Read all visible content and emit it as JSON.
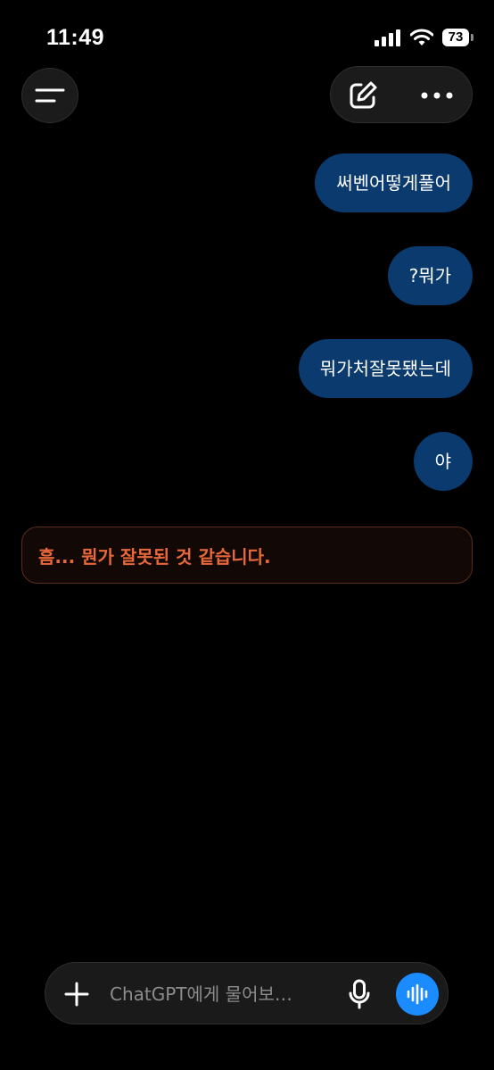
{
  "status_bar": {
    "time": "11:49",
    "battery_level": "73",
    "icons": [
      "signal-icon",
      "wifi-icon",
      "battery-icon"
    ]
  },
  "header": {
    "left_icon": "menu-icon",
    "right_icons": [
      "compose-icon",
      "more-icon"
    ]
  },
  "messages": [
    {
      "role": "user",
      "text": "써벤어떻게풀어"
    },
    {
      "role": "user",
      "text": "?뭐가"
    },
    {
      "role": "user",
      "text": "뭐가처잘못됐는데"
    },
    {
      "role": "user",
      "text": "야"
    }
  ],
  "error": {
    "text": "흠... 뭔가 잘못된 것 같습니다."
  },
  "composer": {
    "placeholder": "ChatGPT에게 물어보…",
    "value": "",
    "icons": [
      "plus-icon",
      "microphone-icon",
      "voice-mode-icon"
    ]
  },
  "colors": {
    "background": "#000000",
    "user_bubble": "#0a3a6e",
    "error_text": "#e8683a",
    "voice_button": "#1a8cff"
  }
}
